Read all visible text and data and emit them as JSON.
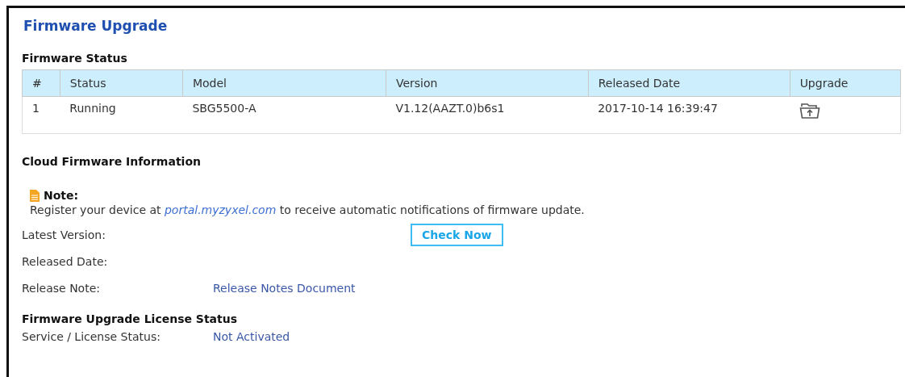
{
  "title": "Firmware Upgrade",
  "firmware_status": {
    "heading": "Firmware Status",
    "columns": [
      "#",
      "Status",
      "Model",
      "Version",
      "Released Date",
      "Upgrade"
    ],
    "rows": [
      {
        "number": "1",
        "status": "Running",
        "model": "SBG5500-A",
        "version": "V1.12(AAZT.0)b6s1",
        "released_date": "2017-10-14 16:39:47"
      }
    ]
  },
  "cloud": {
    "heading": "Cloud Firmware Information",
    "note_label": "Note:",
    "note_text": "Register your device at ",
    "note_link": "portal.myzyxel.com",
    "note_text_after": " to receive automatic notifications of firmware update.",
    "latest_version_label": "Latest Version:",
    "check_button": "Check Now",
    "released_date_label": "Released Date:",
    "release_note_label": "Release Note:",
    "release_note_link": "Release Notes Document"
  },
  "license": {
    "heading": "Firmware Upgrade License Status",
    "service_label": "Service / License Status:",
    "service_value": "Not Activated"
  }
}
